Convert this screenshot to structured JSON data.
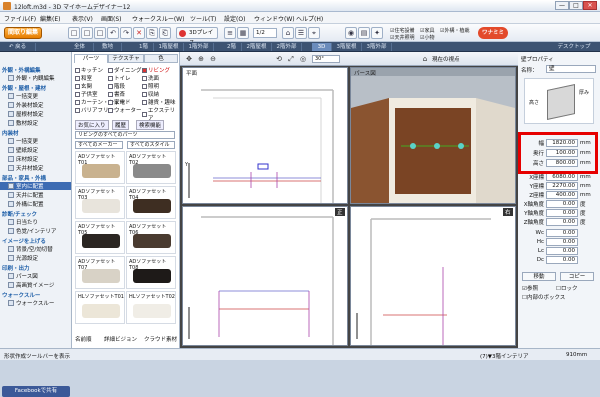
{
  "window": {
    "title": "12loft.m3d - 3D マイホームデザイナー12",
    "btn_min": "—",
    "btn_max": "□",
    "btn_close": "✕"
  },
  "menu": [
    "ファイル(F)",
    "編集(E)",
    "表示(V)",
    "画面(S)",
    "ウォークスルー(W)",
    "ツール(T)",
    "設定(O)",
    "ウィンドウ(W)",
    "ヘルプ(H)"
  ],
  "toolbar": {
    "place_btn": "間取り編集",
    "tools_left": [
      "□",
      "□",
      "□",
      "□",
      "▣",
      "⇱",
      "↶",
      "↷",
      "✕",
      "⎘",
      "⎗"
    ],
    "tools_mid": [
      "≡",
      "▦",
      "⌂"
    ],
    "label_3d": "3Dプレイス",
    "scale_label": "1/2",
    "tools_right": [
      "⌂",
      "☰",
      "⌖"
    ],
    "checks": [
      "住宅設備",
      "天井照明",
      "家具",
      "小物",
      "外構・植栽"
    ],
    "badge": "ワナミミ"
  },
  "modebar": {
    "left": [
      "↶ 戻る",
      "全体",
      "敷地",
      "1階",
      "1階屋根",
      "1階外部",
      "2階",
      "2階屋根",
      "2階外部",
      "3D",
      "3階屋根",
      "3階外部"
    ],
    "right": "デスクトップ"
  },
  "leftnav": {
    "groups": [
      {
        "head": "外観・外構編集",
        "items": [
          "外観・内観編集"
        ]
      },
      {
        "head": "外観・屋根・建材",
        "items": [
          "一括変更",
          "外装材設定",
          "屋根材設定",
          "敷材設定"
        ]
      },
      {
        "head": "内装材",
        "items": [
          "一括変更",
          "壁紙設定",
          "床材設定",
          "天井材設定"
        ]
      },
      {
        "head": "部品・家具・外構",
        "items": [
          "室内に配置",
          "天井に配置",
          "外構に配置"
        ]
      },
      {
        "head": "診断/チェック",
        "items": [
          "日当たり",
          "色覚/インテリア"
        ]
      },
      {
        "head": "イメージを上げる",
        "items": [
          "背景/空/効切替",
          "光源設定"
        ]
      },
      {
        "head": "印刷・出力",
        "items": [
          "パース図",
          "高画質イメージ"
        ]
      },
      {
        "head": "ウォークスルー",
        "items": [
          "ウォークスルー"
        ]
      }
    ],
    "selected": "室内に配置",
    "facebook": "Facebookで共有"
  },
  "parts": {
    "tabs": [
      "パーツ",
      "テクスチャ",
      "色"
    ],
    "categories": [
      [
        "キッチン",
        "ダイニング",
        "リビング"
      ],
      [
        "和室",
        "トイレ",
        "洗面"
      ],
      [
        "玄関",
        "階段",
        "照明"
      ],
      [
        "子供室",
        "書斎",
        "収納"
      ],
      [
        "カーテン・シェード",
        "家電",
        "雑貨・趣味"
      ],
      [
        "バリアフリー",
        "ウォーター",
        "エクステリア"
      ]
    ],
    "selected_category": "リビング",
    "buttons": [
      "お気に入り",
      "履歴",
      "検索機能"
    ],
    "search_placeholder": "リビングのすべてのパーツ",
    "maker": "すべてのメーカー",
    "style": "すべてのスタイル",
    "items": [
      "ADソファセットT01",
      "ADソファセットT02",
      "ADソファセットT03",
      "ADソファセットT04",
      "ADソファセットT05",
      "ADソファセットT06",
      "ADソファセットT07",
      "ADソファセットT08",
      "HLソファセットT01",
      "HLソファセットT02"
    ],
    "footer": [
      "名前順",
      "詳細ビジョン",
      "クラウド素材"
    ]
  },
  "views": {
    "pane_top": "平面",
    "pane_perspective": "パース図",
    "pane_bottom_left": "正",
    "pane_bottom_right": "右",
    "toolbar_text": "現在の視点",
    "angle": "30°"
  },
  "props": {
    "title": "壁プロパティ",
    "name_label": "名称：",
    "name_value": "壁",
    "diagram_labels": [
      "高さ",
      "厚み"
    ],
    "rows": [
      {
        "k": "幅",
        "v": "1820.00",
        "u": "mm"
      },
      {
        "k": "奥行",
        "v": "100.00",
        "u": "mm"
      },
      {
        "k": "高さ",
        "v": "800.00",
        "u": "mm"
      },
      {
        "k": "X座標",
        "v": "6080.00",
        "u": "mm"
      },
      {
        "k": "Y座標",
        "v": "2270.00",
        "u": "mm"
      },
      {
        "k": "Z座標",
        "v": "400.00",
        "u": "mm"
      },
      {
        "k": "X軸角度",
        "v": "0.00",
        "u": "度"
      },
      {
        "k": "Y軸角度",
        "v": "0.00",
        "u": "度"
      },
      {
        "k": "Z軸角度",
        "v": "0.00",
        "u": "度"
      },
      {
        "k": "Wc",
        "v": "0.00",
        "u": ""
      },
      {
        "k": "Hc",
        "v": "0.00",
        "u": ""
      },
      {
        "k": "Lc",
        "v": "0.00",
        "u": ""
      },
      {
        "k": "Dc",
        "v": "0.00",
        "u": ""
      }
    ],
    "btn_move": "移動",
    "btn_copy": "コピー",
    "chk_ref": "参照",
    "chk_lock": "ロック",
    "chk_inner": "内部のボックス"
  },
  "status": {
    "left": "形状作成ツールバーを表示",
    "mode": "(7)▼3階インテリア",
    "value": "910mm"
  }
}
